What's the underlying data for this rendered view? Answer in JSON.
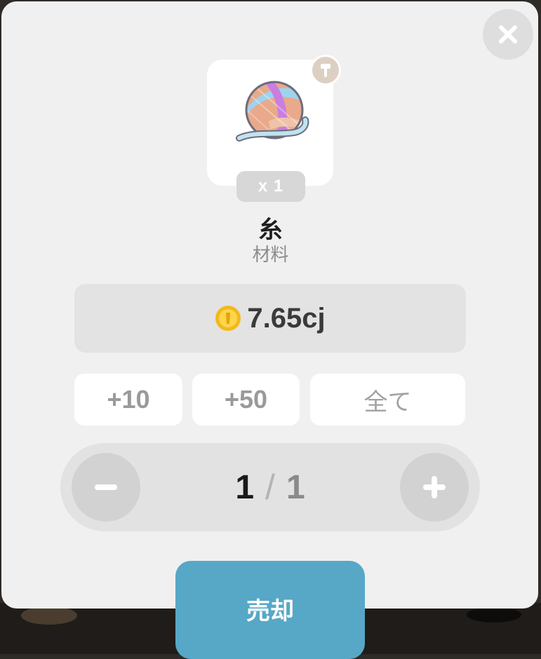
{
  "item": {
    "quantity_badge": "x 1",
    "name": "糸",
    "category": "材料",
    "category_icon": "hammer-icon",
    "image_icon": "yarn-ball-icon"
  },
  "price": {
    "coin_icon": "gold-coin-icon",
    "value": "7.65cj"
  },
  "quick_buttons": {
    "plus10": "+10",
    "plus50": "+50",
    "all": "全て"
  },
  "stepper": {
    "current": "1",
    "separator": "/",
    "max": "1",
    "minus_icon": "minus-icon",
    "plus_icon": "plus-icon"
  },
  "actions": {
    "sell": "売却",
    "close_icon": "close-icon"
  },
  "colors": {
    "sell_button": "#57a7c7",
    "modal_bg": "#f0f0f0"
  }
}
